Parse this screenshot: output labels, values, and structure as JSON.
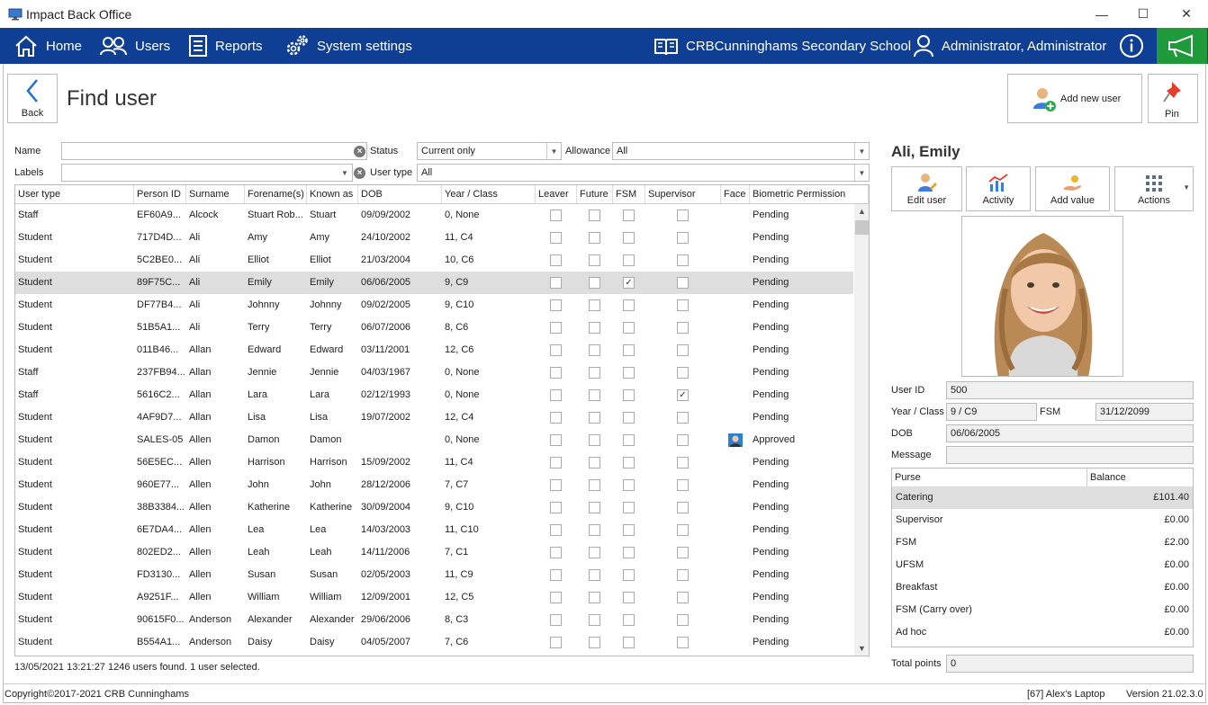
{
  "window": {
    "title": "Impact Back Office",
    "minimize": "—",
    "maximize": "☐",
    "close": "✕"
  },
  "nav": {
    "home": "Home",
    "users": "Users",
    "reports": "Reports",
    "system_settings": "System settings",
    "school": "CRBCunninghams Secondary School",
    "user": "Administrator, Administrator"
  },
  "page": {
    "back": "Back",
    "title": "Find user",
    "add_new_user": "Add new user",
    "pin": "Pin"
  },
  "filters": {
    "name_label": "Name",
    "name_value": "",
    "labels_label": "Labels",
    "labels_value": "",
    "status_label": "Status",
    "status_value": "Current only",
    "allowance_label": "Allowance",
    "allowance_value": "All",
    "usertype_label": "User type",
    "usertype_value": "All"
  },
  "columns": [
    "User type",
    "Person ID",
    "Surname",
    "Forename(s)",
    "Known as",
    "DOB",
    "Year / Class",
    "Leaver",
    "Future",
    "FSM",
    "Supervisor",
    "Face",
    "Biometric Permission"
  ],
  "rows": [
    {
      "type": "Staff",
      "pid": "EF60A9...",
      "surname": "Alcock",
      "forename": "Stuart Rob...",
      "known": "Stuart",
      "dob": "09/09/2002",
      "yc": "0, None",
      "leaver": false,
      "future": false,
      "fsm": false,
      "sup": false,
      "face": false,
      "bio": "Pending",
      "sel": false
    },
    {
      "type": "Student",
      "pid": "717D4D...",
      "surname": "Ali",
      "forename": "Amy",
      "known": "Amy",
      "dob": "24/10/2002",
      "yc": "11, C4",
      "leaver": false,
      "future": false,
      "fsm": false,
      "sup": false,
      "face": false,
      "bio": "Pending",
      "sel": false
    },
    {
      "type": "Student",
      "pid": "5C2BE0...",
      "surname": "Ali",
      "forename": "Elliot",
      "known": "Elliot",
      "dob": "21/03/2004",
      "yc": "10, C6",
      "leaver": false,
      "future": false,
      "fsm": false,
      "sup": false,
      "face": false,
      "bio": "Pending",
      "sel": false
    },
    {
      "type": "Student",
      "pid": "89F75C...",
      "surname": "Ali",
      "forename": "Emily",
      "known": "Emily",
      "dob": "06/06/2005",
      "yc": "9, C9",
      "leaver": false,
      "future": false,
      "fsm": true,
      "sup": false,
      "face": false,
      "bio": "Pending",
      "sel": true
    },
    {
      "type": "Student",
      "pid": "DF77B4...",
      "surname": "Ali",
      "forename": "Johnny",
      "known": "Johnny",
      "dob": "09/02/2005",
      "yc": "9, C10",
      "leaver": false,
      "future": false,
      "fsm": false,
      "sup": false,
      "face": false,
      "bio": "Pending",
      "sel": false
    },
    {
      "type": "Student",
      "pid": "51B5A1...",
      "surname": "Ali",
      "forename": "Terry",
      "known": "Terry",
      "dob": "06/07/2006",
      "yc": "8, C6",
      "leaver": false,
      "future": false,
      "fsm": false,
      "sup": false,
      "face": false,
      "bio": "Pending",
      "sel": false
    },
    {
      "type": "Student",
      "pid": "011B46...",
      "surname": "Allan",
      "forename": "Edward",
      "known": "Edward",
      "dob": "03/11/2001",
      "yc": "12, C6",
      "leaver": false,
      "future": false,
      "fsm": false,
      "sup": false,
      "face": false,
      "bio": "Pending",
      "sel": false
    },
    {
      "type": "Staff",
      "pid": "237FB94...",
      "surname": "Allan",
      "forename": "Jennie",
      "known": "Jennie",
      "dob": "04/03/1967",
      "yc": "0, None",
      "leaver": false,
      "future": false,
      "fsm": false,
      "sup": false,
      "face": false,
      "bio": "Pending",
      "sel": false
    },
    {
      "type": "Staff",
      "pid": "5616C2...",
      "surname": "Allan",
      "forename": "Lara",
      "known": "Lara",
      "dob": "02/12/1993",
      "yc": "0, None",
      "leaver": false,
      "future": false,
      "fsm": false,
      "sup": true,
      "face": false,
      "bio": "Pending",
      "sel": false
    },
    {
      "type": "Student",
      "pid": "4AF9D7...",
      "surname": "Allan",
      "forename": "Lisa",
      "known": "Lisa",
      "dob": "19/07/2002",
      "yc": "12, C4",
      "leaver": false,
      "future": false,
      "fsm": false,
      "sup": false,
      "face": false,
      "bio": "Pending",
      "sel": false
    },
    {
      "type": "Student",
      "pid": "SALES-05",
      "surname": "Allen",
      "forename": "Damon",
      "known": "Damon",
      "dob": "",
      "yc": "0, None",
      "leaver": false,
      "future": false,
      "fsm": false,
      "sup": false,
      "face": true,
      "bio": "Approved",
      "sel": false
    },
    {
      "type": "Student",
      "pid": "56E5EC...",
      "surname": "Allen",
      "forename": "Harrison",
      "known": "Harrison",
      "dob": "15/09/2002",
      "yc": "11, C4",
      "leaver": false,
      "future": false,
      "fsm": false,
      "sup": false,
      "face": false,
      "bio": "Pending",
      "sel": false
    },
    {
      "type": "Student",
      "pid": "960E77...",
      "surname": "Allen",
      "forename": "John",
      "known": "John",
      "dob": "28/12/2006",
      "yc": "7, C7",
      "leaver": false,
      "future": false,
      "fsm": false,
      "sup": false,
      "face": false,
      "bio": "Pending",
      "sel": false
    },
    {
      "type": "Student",
      "pid": "38B3384...",
      "surname": "Allen",
      "forename": "Katherine",
      "known": "Katherine",
      "dob": "30/09/2004",
      "yc": "9, C10",
      "leaver": false,
      "future": false,
      "fsm": false,
      "sup": false,
      "face": false,
      "bio": "Pending",
      "sel": false
    },
    {
      "type": "Student",
      "pid": "6E7DA4...",
      "surname": "Allen",
      "forename": "Lea",
      "known": "Lea",
      "dob": "14/03/2003",
      "yc": "11, C10",
      "leaver": false,
      "future": false,
      "fsm": false,
      "sup": false,
      "face": false,
      "bio": "Pending",
      "sel": false
    },
    {
      "type": "Student",
      "pid": "802ED2...",
      "surname": "Allen",
      "forename": "Leah",
      "known": "Leah",
      "dob": "14/11/2006",
      "yc": "7, C1",
      "leaver": false,
      "future": false,
      "fsm": false,
      "sup": false,
      "face": false,
      "bio": "Pending",
      "sel": false
    },
    {
      "type": "Student",
      "pid": "FD3130...",
      "surname": "Allen",
      "forename": "Susan",
      "known": "Susan",
      "dob": "02/05/2003",
      "yc": "11, C9",
      "leaver": false,
      "future": false,
      "fsm": false,
      "sup": false,
      "face": false,
      "bio": "Pending",
      "sel": false
    },
    {
      "type": "Student",
      "pid": "A9251F...",
      "surname": "Allen",
      "forename": "William",
      "known": "William",
      "dob": "12/09/2001",
      "yc": "12, C5",
      "leaver": false,
      "future": false,
      "fsm": false,
      "sup": false,
      "face": false,
      "bio": "Pending",
      "sel": false
    },
    {
      "type": "Student",
      "pid": "90615F0...",
      "surname": "Anderson",
      "forename": "Alexander",
      "known": "Alexander",
      "dob": "29/06/2006",
      "yc": "8, C3",
      "leaver": false,
      "future": false,
      "fsm": false,
      "sup": false,
      "face": false,
      "bio": "Pending",
      "sel": false
    },
    {
      "type": "Student",
      "pid": "B554A1...",
      "surname": "Anderson",
      "forename": "Daisy",
      "known": "Daisy",
      "dob": "04/05/2007",
      "yc": "7, C6",
      "leaver": false,
      "future": false,
      "fsm": false,
      "sup": false,
      "face": false,
      "bio": "Pending",
      "sel": false
    }
  ],
  "status_text": "13/05/2021 13:21:27 1246 users found. 1 user selected.",
  "footer": {
    "copyright": "Copyright©2017-2021 CRB Cunninghams",
    "device": "[67] Alex's Laptop",
    "version": "Version 21.02.3.0"
  },
  "detail": {
    "name": "Ali, Emily",
    "edit_user": "Edit user",
    "activity": "Activity",
    "add_value": "Add value",
    "actions": "Actions",
    "userid_label": "User ID",
    "userid": "500",
    "yearclass_label": "Year / Class",
    "yearclass": "9 / C9",
    "fsm_label": "FSM",
    "fsm": "31/12/2099",
    "dob_label": "DOB",
    "dob": "06/06/2005",
    "message_label": "Message",
    "message": "",
    "purse_header": "Purse",
    "balance_header": "Balance",
    "purses": [
      {
        "name": "Catering",
        "balance": "£101.40",
        "sel": true
      },
      {
        "name": "Supervisor",
        "balance": "£0.00",
        "sel": false
      },
      {
        "name": "FSM",
        "balance": "£2.00",
        "sel": false
      },
      {
        "name": "UFSM",
        "balance": "£0.00",
        "sel": false
      },
      {
        "name": "Breakfast",
        "balance": "£0.00",
        "sel": false
      },
      {
        "name": "FSM (Carry over)",
        "balance": "£0.00",
        "sel": false
      },
      {
        "name": "Ad hoc",
        "balance": "£0.00",
        "sel": false
      }
    ],
    "points_label": "Total points",
    "points": "0"
  }
}
